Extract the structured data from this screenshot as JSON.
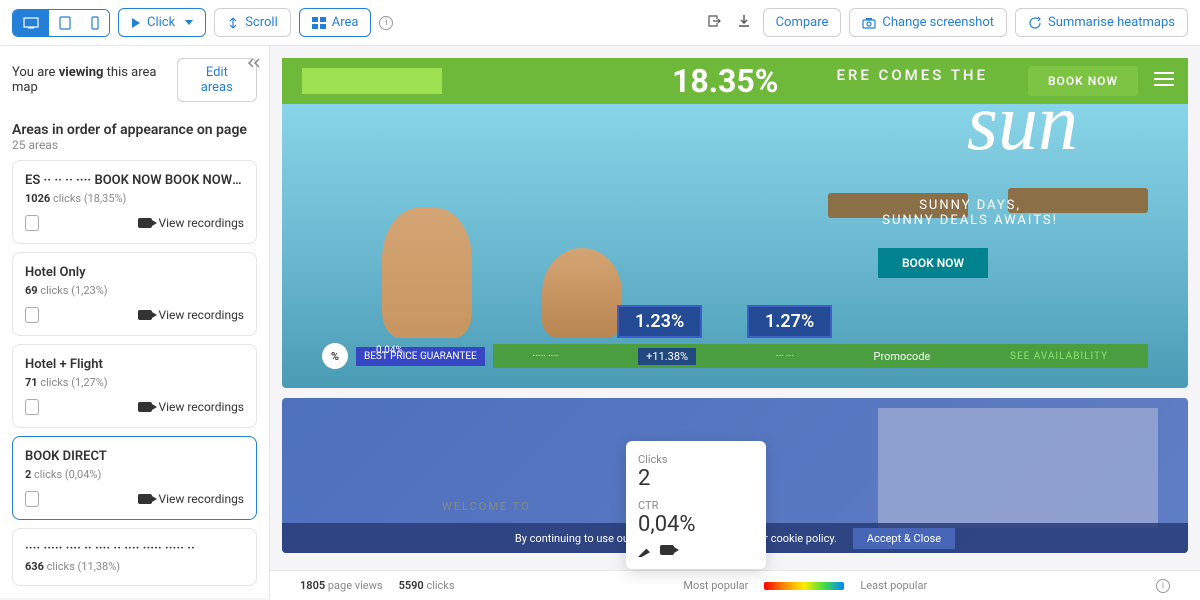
{
  "toolbar": {
    "click": "Click",
    "scroll": "Scroll",
    "area": "Area",
    "compare": "Compare",
    "change": "Change screenshot",
    "summarise": "Summarise heatmaps"
  },
  "sidebar": {
    "viewing_pre": "You are ",
    "viewing_bold": "viewing",
    "viewing_post": " this area map",
    "edit": "Edit areas",
    "title": "Areas in order of appearance on page",
    "count": "25 areas",
    "items": [
      {
        "title": "ES ·· ·· ·· ···· BOOK NOW BOOK NOW Resort Dea",
        "clicks": "1026",
        "pct": "(18,35%)",
        "rec": "View recordings"
      },
      {
        "title": "Hotel Only",
        "clicks": "69",
        "pct": "(1,23%)",
        "rec": "View recordings"
      },
      {
        "title": "Hotel + Flight",
        "clicks": "71",
        "pct": "(1,27%)",
        "rec": "View recordings"
      },
      {
        "title": "BOOK DIRECT",
        "clicks": "2",
        "pct": "(0,04%)",
        "rec": "View recordings"
      },
      {
        "title": "···· ····· ···· ·· ···· ·· ···· ····· ····· ··",
        "clicks": "636",
        "pct": "(11,38%)",
        "rec": ""
      }
    ],
    "clicks_label": "clicks"
  },
  "hero": {
    "pct": "18.35%",
    "comes": "ERE COMES THE",
    "script": "sun",
    "tag1": "SUNNY DAYS,",
    "tag2": "SUNNY DEALS AWAITS!",
    "book": "BOOK NOW",
    "book_top": "BOOK NOW",
    "overlay1": "1.23%",
    "overlay2": "1.27%",
    "bd_pct": "0.04%",
    "bd_label": "BEST PRICE GUARANTEE",
    "search_pct": "+11.38%",
    "promo": "Promocode",
    "avail": "SEE AVAILABILITY"
  },
  "tooltip": {
    "clicks_label": "Clicks",
    "clicks_val": "2",
    "ctr_label": "CTR",
    "ctr_val": "0,04%"
  },
  "lower": {
    "welcome": "WELCOME TO",
    "cookie": "By continuing to use our site you are agreeing to our cookie policy.",
    "accept": "Accept & Close"
  },
  "footer": {
    "views": "1805",
    "views_label": "page views",
    "clicks": "5590",
    "clicks_label": "clicks",
    "popular": "Most popular",
    "least": "Least popular"
  }
}
